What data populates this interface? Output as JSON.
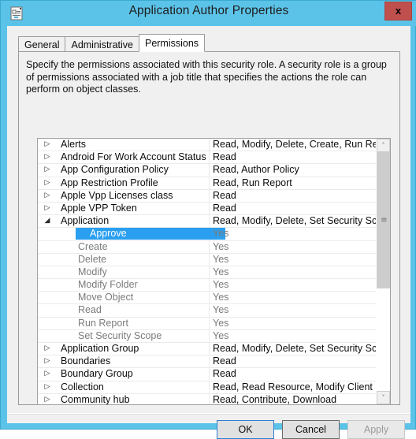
{
  "window": {
    "title": "Application Author Properties",
    "icon": "properties-document-icon",
    "close_label": "x",
    "accent_border": "#5cc3e8",
    "close_color": "#c0504d"
  },
  "tabs": [
    {
      "label": "General",
      "selected": false
    },
    {
      "label": "Administrative Users",
      "selected": false
    },
    {
      "label": "Permissions",
      "selected": true
    }
  ],
  "description": "Specify the permissions associated with this security role. A security role is a group of permissions associated with a job title that specifies the actions the role can perform on object classes.",
  "list": {
    "selection_color": "#2a9ff0",
    "rows": [
      {
        "twisty": "collapsed",
        "level": 0,
        "name": "Alerts",
        "operations": "Read, Modify, Delete, Create, Run Report, M"
      },
      {
        "twisty": "collapsed",
        "level": 0,
        "name": "Android For Work Account Status",
        "operations": "Read"
      },
      {
        "twisty": "collapsed",
        "level": 0,
        "name": "App Configuration Policy",
        "operations": "Read, Author Policy"
      },
      {
        "twisty": "collapsed",
        "level": 0,
        "name": "App Restriction Profile",
        "operations": "Read, Run Report"
      },
      {
        "twisty": "collapsed",
        "level": 0,
        "name": "Apple Vpp Licenses class",
        "operations": "Read"
      },
      {
        "twisty": "collapsed",
        "level": 0,
        "name": "Apple VPP Token",
        "operations": "Read"
      },
      {
        "twisty": "expanded",
        "level": 0,
        "name": "Application",
        "operations": "Read, Modify, Delete, Set Security Scope, Cr"
      },
      {
        "twisty": "none",
        "level": 1,
        "name": "Approve",
        "operations": "Yes",
        "selected": true
      },
      {
        "twisty": "none",
        "level": 1,
        "name": "Create",
        "operations": "Yes"
      },
      {
        "twisty": "none",
        "level": 1,
        "name": "Delete",
        "operations": "Yes"
      },
      {
        "twisty": "none",
        "level": 1,
        "name": "Modify",
        "operations": "Yes"
      },
      {
        "twisty": "none",
        "level": 1,
        "name": "Modify Folder",
        "operations": "Yes"
      },
      {
        "twisty": "none",
        "level": 1,
        "name": "Move Object",
        "operations": "Yes"
      },
      {
        "twisty": "none",
        "level": 1,
        "name": "Read",
        "operations": "Yes"
      },
      {
        "twisty": "none",
        "level": 1,
        "name": "Run Report",
        "operations": "Yes"
      },
      {
        "twisty": "none",
        "level": 1,
        "name": "Set Security Scope",
        "operations": "Yes"
      },
      {
        "twisty": "collapsed",
        "level": 0,
        "name": "Application Group",
        "operations": "Read, Modify, Delete, Set Security Scope, Cr"
      },
      {
        "twisty": "collapsed",
        "level": 0,
        "name": "Boundaries",
        "operations": "Read"
      },
      {
        "twisty": "collapsed",
        "level": 0,
        "name": "Boundary Group",
        "operations": "Read"
      },
      {
        "twisty": "collapsed",
        "level": 0,
        "name": "Collection",
        "operations": "Read, Read Resource, Modify Client Status A"
      },
      {
        "twisty": "collapsed",
        "level": 0,
        "name": "Community hub",
        "operations": "Read, Contribute, Download"
      }
    ]
  },
  "scrollbar": {
    "up_glyph": "˄",
    "down_glyph": "˅",
    "grip_glyph": "≡"
  },
  "footer": {
    "ok": "OK",
    "cancel": "Cancel",
    "apply": "Apply"
  }
}
